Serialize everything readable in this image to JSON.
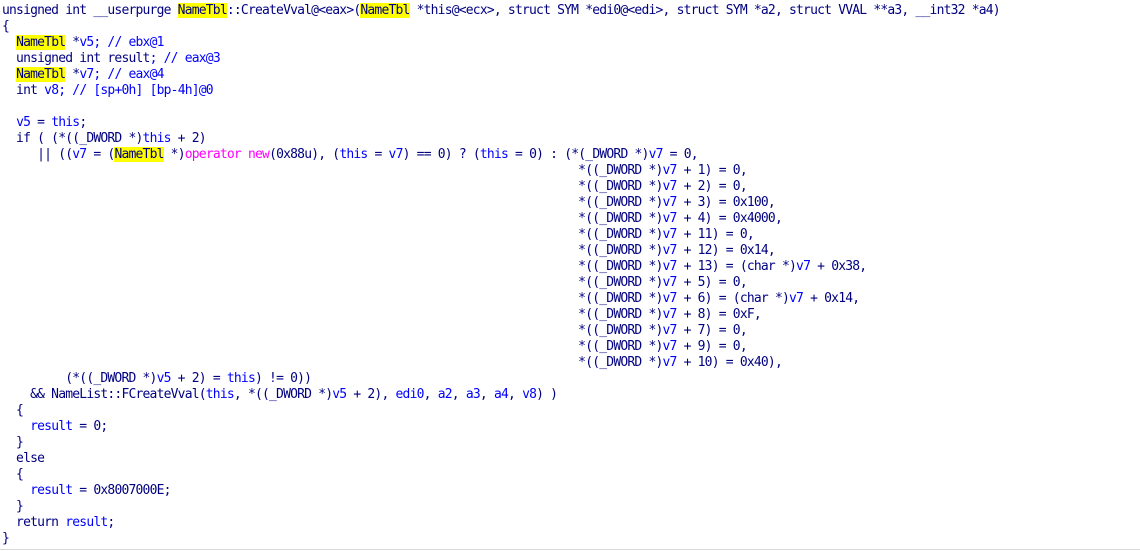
{
  "view": "pseudocode",
  "colors": {
    "background": "#ffffff",
    "text": "#000080",
    "variable": "#0000ff",
    "highlight": "#ffff00",
    "operator_new": "#ff00ff"
  },
  "lines": [
    [
      {
        "t": "unsigned int __userpurge ",
        "c": "kw"
      },
      {
        "t": "NameTbl",
        "c": "hl"
      },
      {
        "t": "::CreateVval@<eax>(",
        "c": "kw"
      },
      {
        "t": "NameTbl",
        "c": "hl"
      },
      {
        "t": " *this@<ecx>, struct SYM *edi0@<edi>, struct SYM *a2, struct VVAL **a3, __int32 *a4)",
        "c": "kw"
      }
    ],
    [
      {
        "t": "{",
        "c": "kw"
      }
    ],
    [
      {
        "t": "  ",
        "c": "kw"
      },
      {
        "t": "NameTbl",
        "c": "hl"
      },
      {
        "t": " *",
        "c": "kw"
      },
      {
        "t": "v5",
        "c": "vr"
      },
      {
        "t": "; // ebx@1",
        "c": "cm"
      }
    ],
    [
      {
        "t": "  unsigned int ",
        "c": "kw"
      },
      {
        "t": "result",
        "c": "kw"
      },
      {
        "t": "; // eax@3",
        "c": "cm"
      }
    ],
    [
      {
        "t": "  ",
        "c": "kw"
      },
      {
        "t": "NameTbl",
        "c": "hl"
      },
      {
        "t": " *",
        "c": "kw"
      },
      {
        "t": "v7",
        "c": "vr"
      },
      {
        "t": "; // eax@4",
        "c": "cm"
      }
    ],
    [
      {
        "t": "  int ",
        "c": "kw"
      },
      {
        "t": "v8",
        "c": "vr"
      },
      {
        "t": "; // [sp+0h] [bp-4h]@0",
        "c": "cm"
      }
    ],
    [
      {
        "t": "",
        "c": "kw"
      }
    ],
    [
      {
        "t": "  ",
        "c": "kw"
      },
      {
        "t": "v5",
        "c": "vr"
      },
      {
        "t": " = ",
        "c": "kw"
      },
      {
        "t": "this",
        "c": "vr"
      },
      {
        "t": ";",
        "c": "kw"
      }
    ],
    [
      {
        "t": "  if ( (*((_DWORD *)",
        "c": "kw"
      },
      {
        "t": "this",
        "c": "vr"
      },
      {
        "t": " + 2)",
        "c": "kw"
      }
    ],
    [
      {
        "t": "     || ((",
        "c": "kw"
      },
      {
        "t": "v7",
        "c": "vr"
      },
      {
        "t": " = (",
        "c": "kw"
      },
      {
        "t": "NameTbl",
        "c": "hl"
      },
      {
        "t": " *)",
        "c": "kw"
      },
      {
        "t": "operator new",
        "c": "op"
      },
      {
        "t": "(0x88u), (",
        "c": "kw"
      },
      {
        "t": "this",
        "c": "vr"
      },
      {
        "t": " = ",
        "c": "kw"
      },
      {
        "t": "v7",
        "c": "vr"
      },
      {
        "t": ") == 0) ? (",
        "c": "kw"
      },
      {
        "t": "this",
        "c": "vr"
      },
      {
        "t": " = 0) : (*(_DWORD *)",
        "c": "kw"
      },
      {
        "t": "v7",
        "c": "vr"
      },
      {
        "t": " = 0,",
        "c": "kw"
      }
    ],
    [
      {
        "t": "                                                                                  *((_DWORD *)",
        "c": "kw"
      },
      {
        "t": "v7",
        "c": "vr"
      },
      {
        "t": " + 1) = 0,",
        "c": "kw"
      }
    ],
    [
      {
        "t": "                                                                                  *((_DWORD *)",
        "c": "kw"
      },
      {
        "t": "v7",
        "c": "vr"
      },
      {
        "t": " + 2) = 0,",
        "c": "kw"
      }
    ],
    [
      {
        "t": "                                                                                  *((_DWORD *)",
        "c": "kw"
      },
      {
        "t": "v7",
        "c": "vr"
      },
      {
        "t": " + 3) = 0x100,",
        "c": "kw"
      }
    ],
    [
      {
        "t": "                                                                                  *((_DWORD *)",
        "c": "kw"
      },
      {
        "t": "v7",
        "c": "vr"
      },
      {
        "t": " + 4) = 0x4000,",
        "c": "kw"
      }
    ],
    [
      {
        "t": "                                                                                  *((_DWORD *)",
        "c": "kw"
      },
      {
        "t": "v7",
        "c": "vr"
      },
      {
        "t": " + 11) = 0,",
        "c": "kw"
      }
    ],
    [
      {
        "t": "                                                                                  *((_DWORD *)",
        "c": "kw"
      },
      {
        "t": "v7",
        "c": "vr"
      },
      {
        "t": " + 12) = 0x14,",
        "c": "kw"
      }
    ],
    [
      {
        "t": "                                                                                  *((_DWORD *)",
        "c": "kw"
      },
      {
        "t": "v7",
        "c": "vr"
      },
      {
        "t": " + 13) = (char *)",
        "c": "kw"
      },
      {
        "t": "v7",
        "c": "vr"
      },
      {
        "t": " + 0x38,",
        "c": "kw"
      }
    ],
    [
      {
        "t": "                                                                                  *((_DWORD *)",
        "c": "kw"
      },
      {
        "t": "v7",
        "c": "vr"
      },
      {
        "t": " + 5) = 0,",
        "c": "kw"
      }
    ],
    [
      {
        "t": "                                                                                  *((_DWORD *)",
        "c": "kw"
      },
      {
        "t": "v7",
        "c": "vr"
      },
      {
        "t": " + 6) = (char *)",
        "c": "kw"
      },
      {
        "t": "v7",
        "c": "vr"
      },
      {
        "t": " + 0x14,",
        "c": "kw"
      }
    ],
    [
      {
        "t": "                                                                                  *((_DWORD *)",
        "c": "kw"
      },
      {
        "t": "v7",
        "c": "vr"
      },
      {
        "t": " + 8) = 0xF,",
        "c": "kw"
      }
    ],
    [
      {
        "t": "                                                                                  *((_DWORD *)",
        "c": "kw"
      },
      {
        "t": "v7",
        "c": "vr"
      },
      {
        "t": " + 7) = 0,",
        "c": "kw"
      }
    ],
    [
      {
        "t": "                                                                                  *((_DWORD *)",
        "c": "kw"
      },
      {
        "t": "v7",
        "c": "vr"
      },
      {
        "t": " + 9) = 0,",
        "c": "kw"
      }
    ],
    [
      {
        "t": "                                                                                  *((_DWORD *)",
        "c": "kw"
      },
      {
        "t": "v7",
        "c": "vr"
      },
      {
        "t": " + 10) = 0x40),",
        "c": "kw"
      }
    ],
    [
      {
        "t": "         (*((_DWORD *)",
        "c": "kw"
      },
      {
        "t": "v5",
        "c": "vr"
      },
      {
        "t": " + 2) = ",
        "c": "kw"
      },
      {
        "t": "this",
        "c": "vr"
      },
      {
        "t": ") != 0))",
        "c": "kw"
      }
    ],
    [
      {
        "t": "    && NameList::FCreateVval(",
        "c": "kw"
      },
      {
        "t": "this",
        "c": "vr"
      },
      {
        "t": ", *((_DWORD *)",
        "c": "kw"
      },
      {
        "t": "v5",
        "c": "vr"
      },
      {
        "t": " + 2), ",
        "c": "kw"
      },
      {
        "t": "edi0",
        "c": "vr"
      },
      {
        "t": ", ",
        "c": "kw"
      },
      {
        "t": "a2",
        "c": "vr"
      },
      {
        "t": ", ",
        "c": "kw"
      },
      {
        "t": "a3",
        "c": "vr"
      },
      {
        "t": ", ",
        "c": "kw"
      },
      {
        "t": "a4",
        "c": "vr"
      },
      {
        "t": ", ",
        "c": "kw"
      },
      {
        "t": "v8",
        "c": "vr"
      },
      {
        "t": ") )",
        "c": "kw"
      }
    ],
    [
      {
        "t": "  {",
        "c": "kw"
      }
    ],
    [
      {
        "t": "    ",
        "c": "kw"
      },
      {
        "t": "result",
        "c": "vr"
      },
      {
        "t": " = 0;",
        "c": "kw"
      }
    ],
    [
      {
        "t": "  }",
        "c": "kw"
      }
    ],
    [
      {
        "t": "  else",
        "c": "kw"
      }
    ],
    [
      {
        "t": "  {",
        "c": "kw"
      }
    ],
    [
      {
        "t": "    ",
        "c": "kw"
      },
      {
        "t": "result",
        "c": "vr"
      },
      {
        "t": " = 0x8007000E;",
        "c": "kw"
      }
    ],
    [
      {
        "t": "  }",
        "c": "kw"
      }
    ],
    [
      {
        "t": "  return ",
        "c": "kw"
      },
      {
        "t": "result",
        "c": "vr"
      },
      {
        "t": ";",
        "c": "kw"
      }
    ],
    [
      {
        "t": "}",
        "c": "kw"
      }
    ]
  ]
}
